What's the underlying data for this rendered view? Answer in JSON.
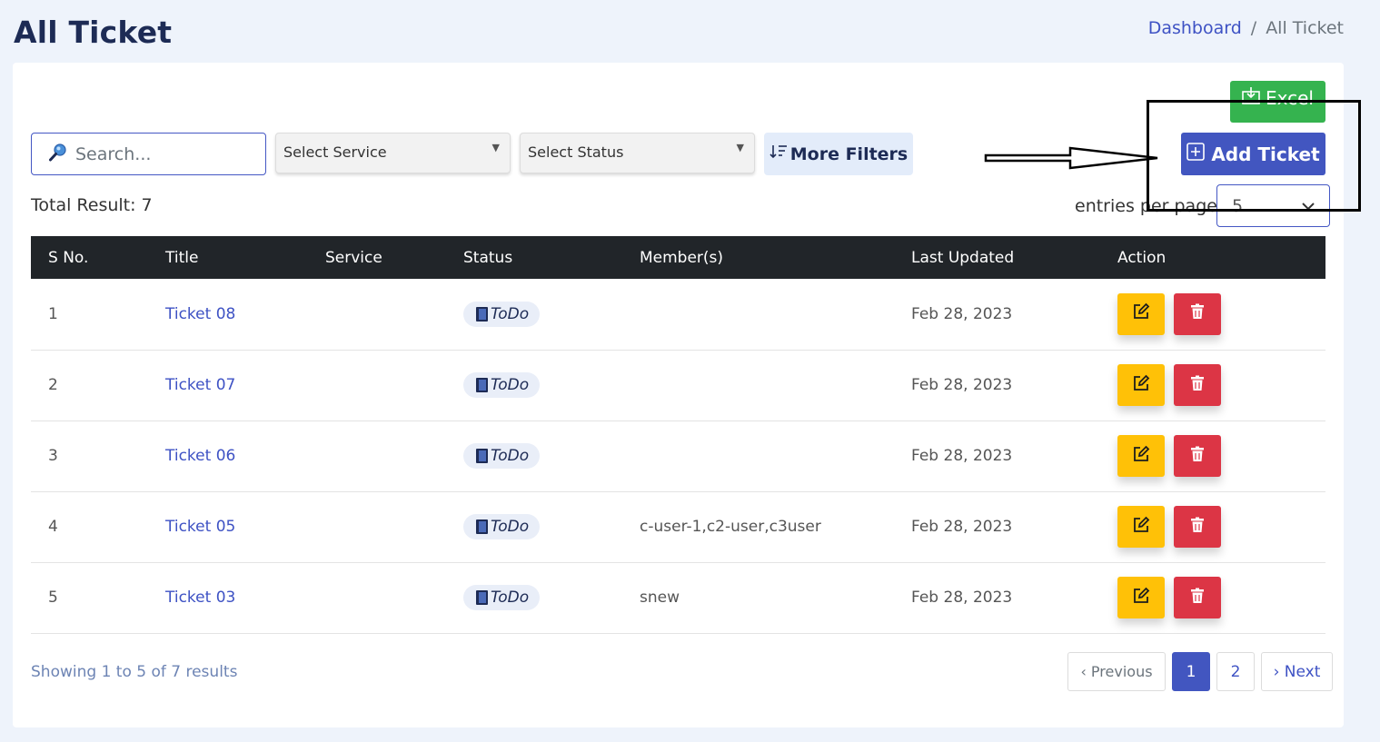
{
  "header": {
    "title": "All Ticket",
    "breadcrumb": {
      "link": "Dashboard",
      "separator": "/",
      "current": "All Ticket"
    }
  },
  "toolbar": {
    "excel_label": "Excel",
    "search_placeholder": "Search...",
    "service_select": "Select Service",
    "status_select": "Select Status",
    "more_filters_label": "More Filters",
    "add_ticket_label": "Add Ticket"
  },
  "summary": {
    "total_result": "Total Result: 7",
    "entries_label": "entries per page",
    "entries_value": "5"
  },
  "table": {
    "columns": [
      "S No.",
      "Title",
      "Service",
      "Status",
      "Member(s)",
      "Last Updated",
      "Action"
    ],
    "rows": [
      {
        "sno": "1",
        "title": "Ticket 08",
        "service": "",
        "status": "ToDo",
        "members": "",
        "updated": "Feb 28, 2023"
      },
      {
        "sno": "2",
        "title": "Ticket 07",
        "service": "",
        "status": "ToDo",
        "members": "",
        "updated": "Feb 28, 2023"
      },
      {
        "sno": "3",
        "title": "Ticket 06",
        "service": "",
        "status": "ToDo",
        "members": "",
        "updated": "Feb 28, 2023"
      },
      {
        "sno": "4",
        "title": "Ticket 05",
        "service": "",
        "status": "ToDo",
        "members": "c-user-1,c2-user,c3user",
        "updated": "Feb 28, 2023"
      },
      {
        "sno": "5",
        "title": "Ticket 03",
        "service": "",
        "status": "ToDo",
        "members": "snew",
        "updated": "Feb 28, 2023"
      }
    ]
  },
  "footer": {
    "showing": "Showing 1 to 5 of 7 results",
    "pagination": {
      "previous": "‹ Previous",
      "pages": [
        "1",
        "2"
      ],
      "next": "› Next",
      "current_page": "1"
    }
  },
  "colors": {
    "primary": "#4256c0",
    "excel": "#35b34f",
    "edit": "#ffc107",
    "delete": "#dc3545",
    "table_header": "#212529"
  },
  "icons": {
    "search": "search-icon",
    "excel": "download-icon",
    "filter": "sort-icon",
    "add": "plus-square-icon",
    "status": "door-icon",
    "edit": "edit-icon",
    "delete": "trash-icon"
  }
}
